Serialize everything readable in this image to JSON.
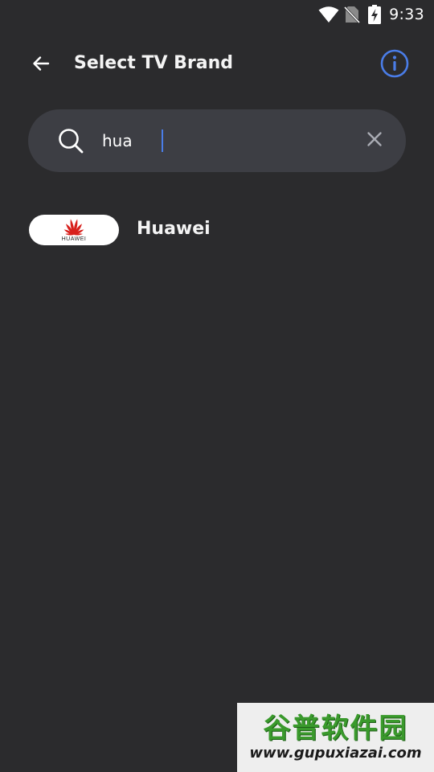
{
  "status_bar": {
    "time": "9:33",
    "icons": [
      "wifi-icon",
      "no-sim-icon",
      "battery-charging-icon"
    ]
  },
  "app_bar": {
    "back_icon": "arrow-left-icon",
    "title": "Select TV Brand",
    "info_icon": "info-circle-icon"
  },
  "search": {
    "value": "hua",
    "search_icon": "magnifier-icon",
    "clear_icon": "close-icon"
  },
  "results": [
    {
      "name": "Huawei",
      "logo_text": "HUAWEI"
    }
  ],
  "watermark": {
    "title": "谷普软件园",
    "url": "www.gupuxiazai.com"
  },
  "colors": {
    "background": "#2b2b2d",
    "search_background": "#3d3e44",
    "accent": "#4a7de8",
    "huawei_red": "#d8201c",
    "text_primary": "#f4f4f4",
    "icon_muted": "#a9abb3",
    "watermark_green": "#3a9a2c"
  }
}
